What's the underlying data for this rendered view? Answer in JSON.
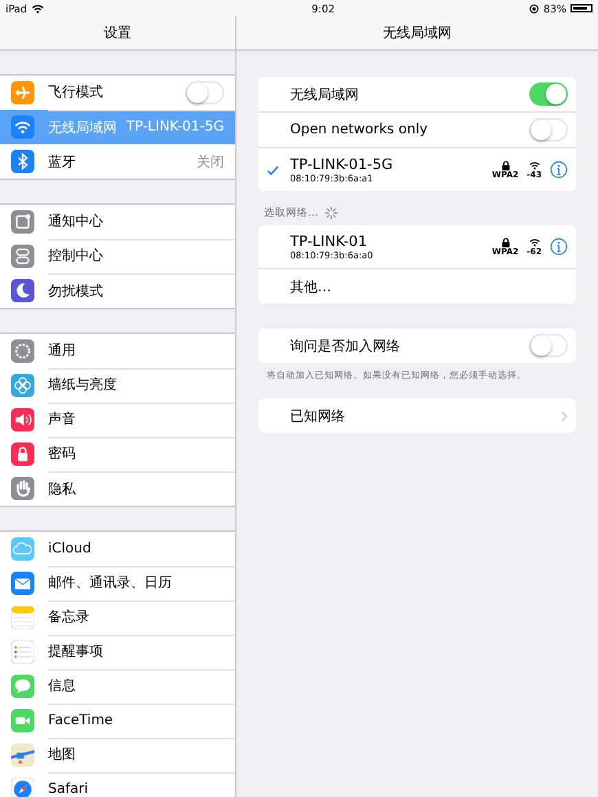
{
  "status_bar": {
    "device": "iPad",
    "time": "9:02",
    "battery": "83%"
  },
  "sidebar": {
    "title": "设置",
    "groups": [
      [
        {
          "label": "飞行模式",
          "kind": "toggle",
          "on": false,
          "selected": false
        },
        {
          "label": "无线局域网",
          "kind": "value",
          "value": "TP-LINK-01-5G",
          "selected": true
        },
        {
          "label": "蓝牙",
          "kind": "value",
          "value": "关闭",
          "selected": false
        }
      ],
      [
        {
          "label": "通知中心",
          "kind": "plain",
          "selected": false
        },
        {
          "label": "控制中心",
          "kind": "plain",
          "selected": false
        },
        {
          "label": "勿扰模式",
          "kind": "plain",
          "selected": false
        }
      ],
      [
        {
          "label": "通用",
          "kind": "plain",
          "selected": false
        },
        {
          "label": "墙纸与亮度",
          "kind": "plain",
          "selected": false
        },
        {
          "label": "声音",
          "kind": "plain",
          "selected": false
        },
        {
          "label": "密码",
          "kind": "plain",
          "selected": false
        },
        {
          "label": "隐私",
          "kind": "plain",
          "selected": false
        }
      ],
      [
        {
          "label": "iCloud",
          "kind": "plain",
          "selected": false
        },
        {
          "label": "邮件、通讯录、日历",
          "kind": "plain",
          "selected": false
        },
        {
          "label": "备忘录",
          "kind": "plain",
          "selected": false
        },
        {
          "label": "提醒事项",
          "kind": "plain",
          "selected": false
        },
        {
          "label": "信息",
          "kind": "plain",
          "selected": false
        },
        {
          "label": "FaceTime",
          "kind": "plain",
          "selected": false
        },
        {
          "label": "地图",
          "kind": "plain",
          "selected": false
        },
        {
          "label": "Safari",
          "kind": "plain",
          "selected": false
        }
      ]
    ]
  },
  "detail": {
    "title": "无线局域网",
    "switches": [
      {
        "label": "无线局域网",
        "on": true
      },
      {
        "label": "Open networks only",
        "on": false
      }
    ],
    "connected": {
      "name": "TP-LINK-01-5G",
      "mac": "08:10:79:3b:6a:a1",
      "security": "WPA2",
      "signal": "-43",
      "checked": true
    },
    "choose_label": "选取网络…",
    "networks": [
      {
        "name": "TP-LINK-01",
        "mac": "08:10:79:3b:6a:a0",
        "security": "WPA2",
        "signal": "-62"
      }
    ],
    "other": "其他…",
    "ask": {
      "label": "询问是否加入网络",
      "on": false
    },
    "ask_note": "将自动加入已知网络。如果没有已知网络，您必须手动选择。",
    "known": "已知网络"
  }
}
